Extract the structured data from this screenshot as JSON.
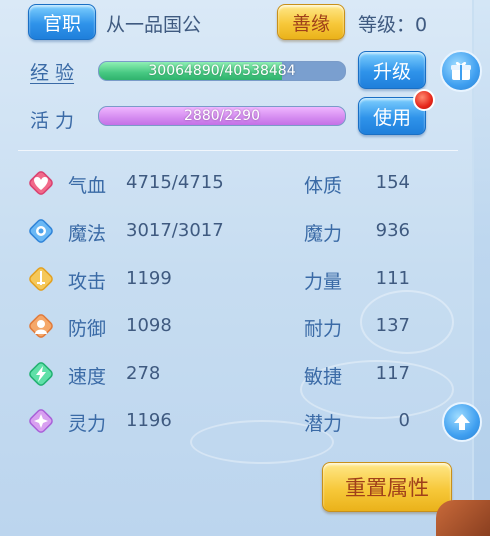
{
  "header": {
    "rank_button": "官职",
    "rank_title": "从一品国公",
    "karma_button": "善缘",
    "level_label": "等级：0"
  },
  "experience": {
    "label": "经 验",
    "bar_text": "30064890/40538484",
    "progress": 0.742,
    "upgrade_button": "升级"
  },
  "vitality": {
    "label": "活 力",
    "bar_text": "2880/2290",
    "progress": 1.0,
    "use_button": "使用"
  },
  "stats_left": [
    {
      "name": "气血",
      "value": "4715/4715",
      "icon": "heart-icon"
    },
    {
      "name": "魔法",
      "value": "3017/3017",
      "icon": "mana-icon"
    },
    {
      "name": "攻击",
      "value": "1199",
      "icon": "sword-icon"
    },
    {
      "name": "防御",
      "value": "1098",
      "icon": "defense-icon"
    },
    {
      "name": "速度",
      "value": "278",
      "icon": "speed-icon"
    },
    {
      "name": "灵力",
      "value": "1196",
      "icon": "spirit-icon"
    }
  ],
  "stats_right": [
    {
      "name": "体质",
      "value": "154"
    },
    {
      "name": "魔力",
      "value": "936"
    },
    {
      "name": "力量",
      "value": "111"
    },
    {
      "name": "耐力",
      "value": "137"
    },
    {
      "name": "敏捷",
      "value": "117"
    },
    {
      "name": "潜力",
      "value": "0"
    }
  ],
  "reset_button": "重置属性",
  "colors": {
    "exp_fill": "#4ed08a",
    "vitality_fill": "#d98cf0",
    "button_blue": "#2f93ea",
    "button_gold": "#f7c83a"
  }
}
